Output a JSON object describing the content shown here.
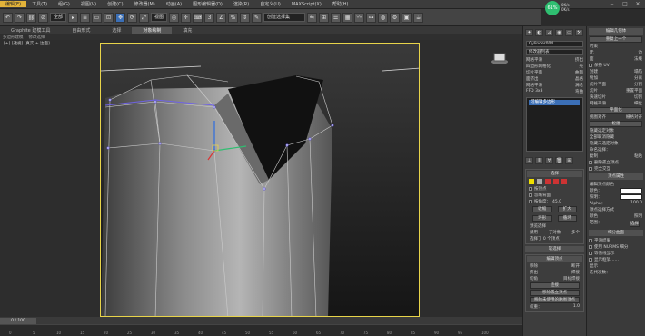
{
  "menu": {
    "items": [
      "编辑(E)",
      "工具(T)",
      "组(G)",
      "视图(V)",
      "创建(C)",
      "修改器(M)",
      "动画(A)",
      "图形编辑器(D)",
      "渲染(R)",
      "自定义(U)",
      "MAXScript(X)",
      "帮助(H)"
    ]
  },
  "toolbar": {
    "select_filter": "全部",
    "view_dropdown": "视图",
    "selection_set": "创建选择集"
  },
  "status": {
    "badge": "61%",
    "net_up": "0K/s",
    "net_down": "0K/s"
  },
  "ribbon": {
    "tabs": [
      "Graphite 建模工具",
      "自由形式",
      "选择",
      "对象绘制",
      "填充"
    ],
    "sub": [
      "多边形建模",
      "修改选择"
    ]
  },
  "viewport": {
    "label": "[+] [透视] [真实 + 边面]"
  },
  "timeline": {
    "frame": "0 / 100",
    "ticks": [
      "0",
      "5",
      "10",
      "15",
      "20",
      "25",
      "30",
      "35",
      "40",
      "45",
      "50",
      "55",
      "60",
      "65",
      "70",
      "75",
      "80",
      "85",
      "90",
      "95",
      "100"
    ]
  },
  "cmd": {
    "object_name": "Cylinder004",
    "modifier_list": "修改器列表",
    "buttons": [
      [
        "网格平滑",
        "挤出"
      ],
      [
        "四边形网格化",
        "壳"
      ],
      [
        "切片平面",
        "曲面"
      ],
      [
        "面挤出",
        "晶格"
      ],
      [
        "网格平滑",
        "涡轮"
      ],
      [
        "FFD 3x3",
        "弯曲"
      ]
    ],
    "stack_item": "可编辑多边形",
    "selection": {
      "title": "选择",
      "by_vertex": "按顶点",
      "ignore_back": "忽略背面",
      "angle_label": "按角度：",
      "angle_val": "45.0",
      "shrink": "收缩",
      "grow": "扩大",
      "ring": "环形",
      "loop": "循环",
      "preview": "预览选择",
      "disabled": "禁用",
      "subobject": "子对象",
      "multi": "多个",
      "info": "选择了 0 个顶点"
    },
    "soft": {
      "title": "软选择"
    },
    "edit_vertex": {
      "title": "编辑顶点",
      "b1": [
        "移除",
        "断开"
      ],
      "b2": [
        "挤出",
        "焊接"
      ],
      "b3": [
        "切角",
        "目标焊接"
      ],
      "connect": "连接",
      "remove_iso": "移除孤立顶点",
      "remove_unused": "移除未使用的贴图顶点",
      "weight_label": "权重：",
      "weight_val": "1.0"
    }
  },
  "right": {
    "title": "编辑几何体",
    "repeat": "重复上一个",
    "constraint_title": "约束",
    "c_none": "无",
    "c_edge": "边",
    "c_face": "面",
    "c_normal": "法线",
    "keep_uv": "保持 UV",
    "create": "创建",
    "collapse": "塌陷",
    "attach": "附加",
    "detach": "分离",
    "slice_plane": "切片平面",
    "split": "分割",
    "slice": "切片",
    "reset_plane": "重置平面",
    "quickslice": "快速切片",
    "cut": "切割",
    "meshsmooth": "网格平滑",
    "tessellate": "细化",
    "planarize": "平面化",
    "view_align": "视图对齐",
    "grid_align": "栅格对齐",
    "relax": "松弛",
    "hide_sel": "隐藏选定对象",
    "unhide_all": "全部取消隐藏",
    "hide_unsel": "隐藏未选定对象",
    "named_sel": "命名选择：",
    "copy": "复制",
    "paste": "粘贴",
    "delete_iso": "删除孤立顶点",
    "full_interact": "完全交互",
    "surface_props": "顶点属性",
    "edit_color": "编辑顶点颜色",
    "color_lbl": "颜色：",
    "illum_lbl": "照明：",
    "alpha_lbl": "Alpha：",
    "alpha_val": "100.0",
    "select_by": "顶点选择方式",
    "color_opt": "颜色",
    "illum_opt": "照明",
    "range_lbl": "范围：",
    "select_btn": "选择",
    "subdiv_title": "细分曲面",
    "smooth_result": "平滑结果",
    "use_nurms": "使用 NURMS 细分",
    "iso_lines": "等值线显示",
    "show_cage": "显示框架……",
    "display_lbl": "显示",
    "iter_lbl": "迭代次数："
  },
  "colors": {
    "accent": "#e8d44a",
    "select_blue": "#3b6fb6",
    "gizmo_z": "#2d6cdf",
    "gizmo_y": "#2fbf71",
    "gizmo_x": "#d33"
  }
}
